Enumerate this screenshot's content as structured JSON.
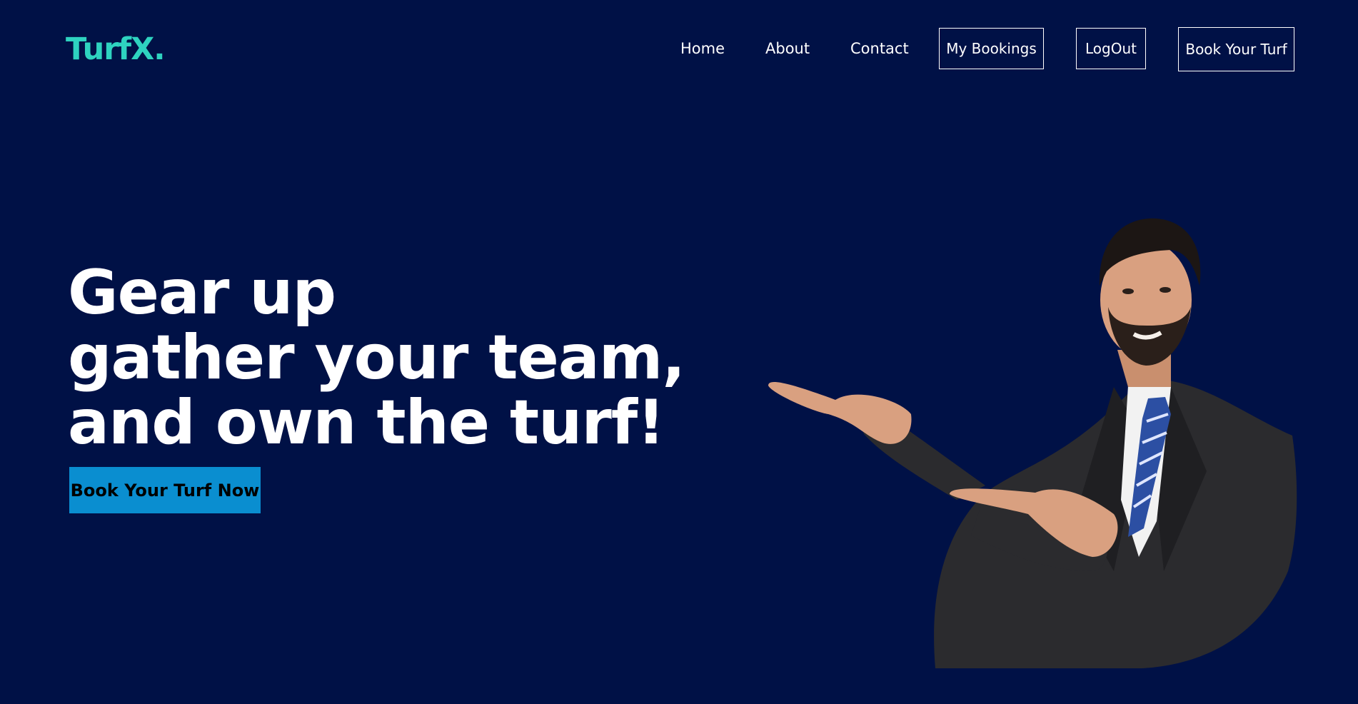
{
  "brand": {
    "logo_text": "TurfX.",
    "accent_color": "#2ed3c0",
    "background_color": "#001146"
  },
  "nav": {
    "links": [
      "Home",
      "About",
      "Contact"
    ],
    "buttons": [
      "My Bookings",
      "LogOut",
      "Book Your Turf"
    ]
  },
  "hero": {
    "title_lines": [
      "Gear up",
      "gather your team,",
      "and own the turf!"
    ],
    "cta_label": "Book Your Turf Now",
    "cta_color": "#0a8ed0",
    "image_subject": "businessman-pointing-photo"
  }
}
